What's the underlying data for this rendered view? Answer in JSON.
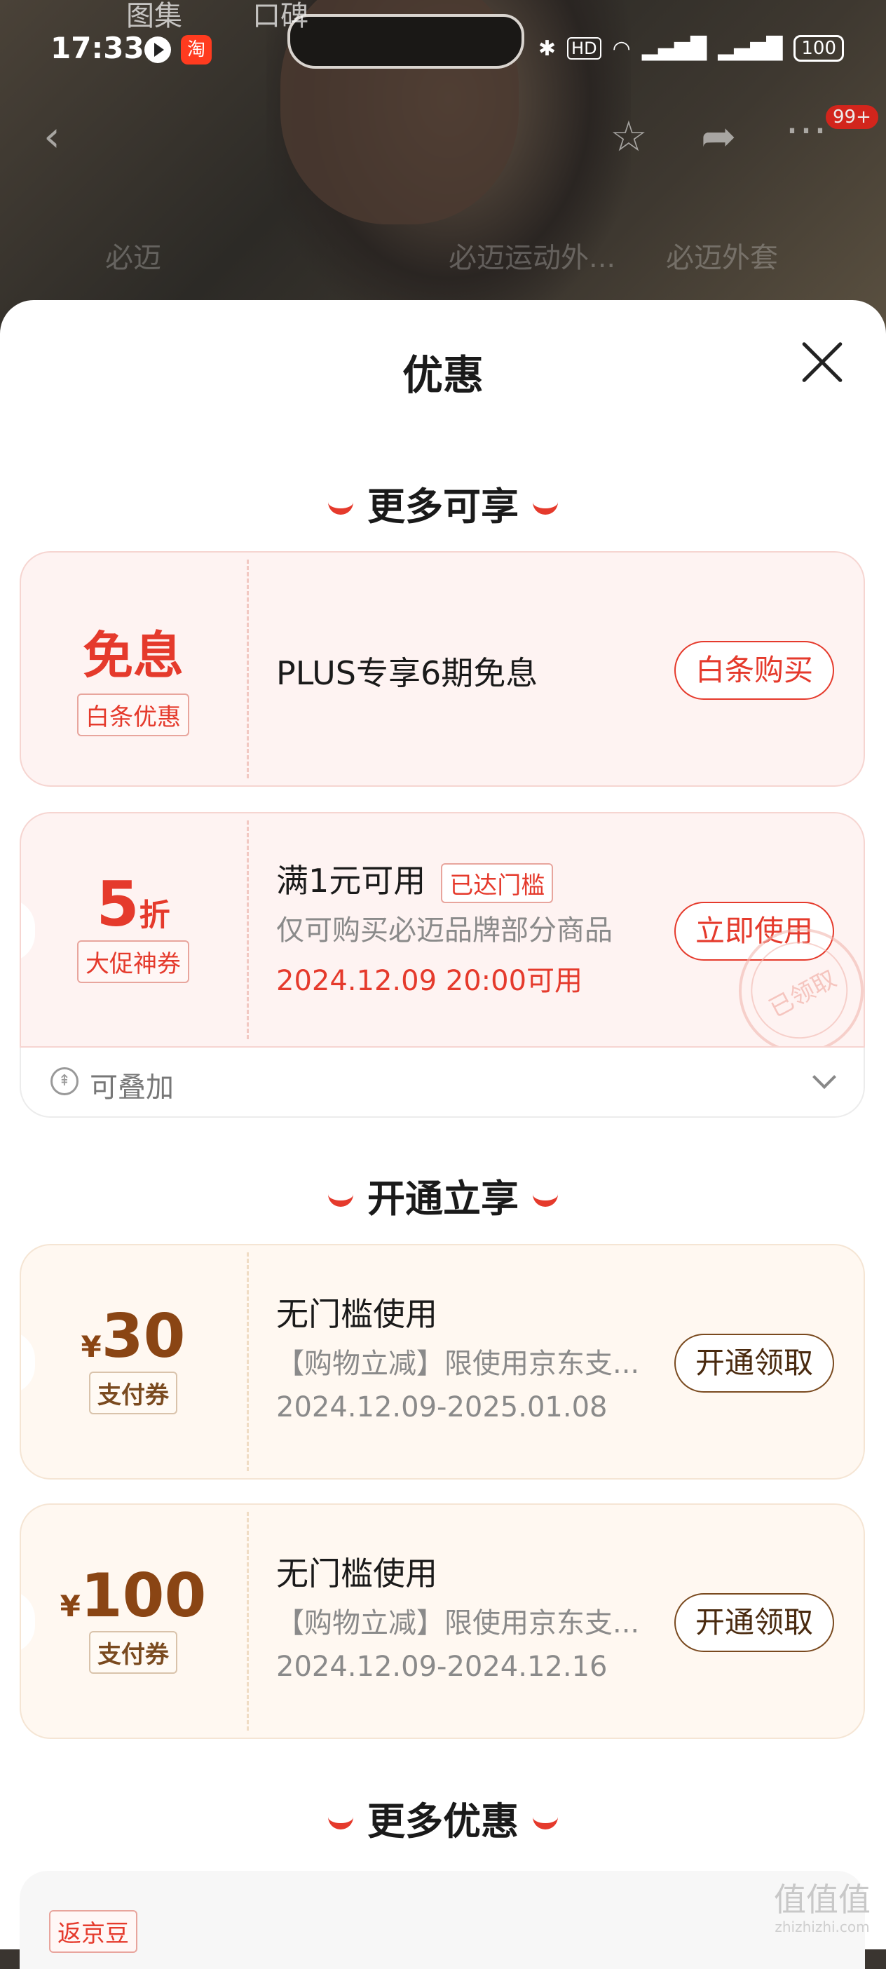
{
  "status": {
    "time": "17:33",
    "tao_label": "淘",
    "battery": "100"
  },
  "bg": {
    "tab1": "图集",
    "tab2": "口碑",
    "ghost1": "必迈",
    "ghost2": "必迈运动外...",
    "ghost3": "必迈外套",
    "badge": "99+"
  },
  "sheet": {
    "title": "优惠"
  },
  "sections": {
    "s1": "更多可享",
    "s2": "开通立享",
    "s3": "更多优惠"
  },
  "card1": {
    "big": "免息",
    "tag": "白条优惠",
    "title": "PLUS专享6期免息",
    "button": "白条购买"
  },
  "card2": {
    "num": "5",
    "unit": "折",
    "tag": "大促神券",
    "title": "满1元可用",
    "reached": "已达门槛",
    "desc": "仅可购买必迈品牌部分商品",
    "date": "2024.12.09 20:00可用",
    "button": "立即使用",
    "stamp": "已领取",
    "stack": "可叠加"
  },
  "card3": {
    "currency": "¥",
    "amount": "30",
    "tag": "支付券",
    "title": "无门槛使用",
    "desc": "【购物立减】限使用京东支...",
    "date": "2024.12.09-2025.01.08",
    "button": "开通领取"
  },
  "card4": {
    "currency": "¥",
    "amount": "100",
    "tag": "支付券",
    "title": "无门槛使用",
    "desc": "【购物立减】限使用京东支...",
    "date": "2024.12.09-2024.12.16",
    "button": "开通领取"
  },
  "more": {
    "tag": "返京豆"
  },
  "watermark": {
    "text": "值值值",
    "url": "zhizhizhi.com"
  },
  "colors": {
    "accent": "#e53a2c",
    "brown": "#8a4514"
  }
}
